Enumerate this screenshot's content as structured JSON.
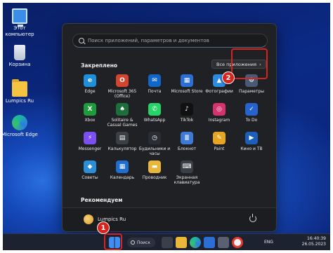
{
  "desktop": {
    "icons": [
      {
        "label": "Этот компьютер",
        "icon": "this-pc-icon"
      },
      {
        "label": "Корзина",
        "icon": "recycle-bin-icon"
      },
      {
        "label": "Lumpics Ru",
        "icon": "folder-icon"
      },
      {
        "label": "Microsoft Edge",
        "icon": "edge-icon"
      }
    ]
  },
  "start_menu": {
    "search_placeholder": "Поиск приложений, параметров и документов",
    "pinned_title": "Закреплено",
    "all_apps_label": "Все приложения",
    "all_apps_chevron": "›",
    "apps": [
      {
        "label": "Edge",
        "color": "#1f8fdc",
        "glyph": "e"
      },
      {
        "label": "Microsoft 365 (Office)",
        "color": "#d4452f",
        "glyph": "O"
      },
      {
        "label": "Почта",
        "color": "#1266c8",
        "glyph": "✉"
      },
      {
        "label": "Microsoft Store",
        "color": "#2c6fd4",
        "glyph": "▦"
      },
      {
        "label": "Фотографии",
        "color": "#2b8be0",
        "glyph": "▲"
      },
      {
        "label": "Параметры",
        "color": "#4a5a74",
        "glyph": "⚙"
      },
      {
        "label": "Xbox",
        "color": "#1e9c3c",
        "glyph": "X"
      },
      {
        "label": "Solitaire & Casual Games",
        "color": "#1c6e3a",
        "glyph": "♠"
      },
      {
        "label": "WhatsApp",
        "color": "#25d366",
        "glyph": "✆"
      },
      {
        "label": "TikTok",
        "color": "#111111",
        "glyph": "♪"
      },
      {
        "label": "Instagram",
        "color": "#d6336c",
        "glyph": "◎"
      },
      {
        "label": "To Do",
        "color": "#2564cf",
        "glyph": "✓"
      },
      {
        "label": "Messenger",
        "color": "#7b4ff0",
        "glyph": "⚡"
      },
      {
        "label": "Калькулятор",
        "color": "#3b3f46",
        "glyph": "▤"
      },
      {
        "label": "Будильники и часы",
        "color": "#2a2d33",
        "glyph": "◷"
      },
      {
        "label": "Блокнот",
        "color": "#3c7ad6",
        "glyph": "≣"
      },
      {
        "label": "Paint",
        "color": "#e8a521",
        "glyph": "✎"
      },
      {
        "label": "Кино и ТВ",
        "color": "#1b5fb8",
        "glyph": "▶"
      },
      {
        "label": "Советы",
        "color": "#2a8fd8",
        "glyph": "◆"
      },
      {
        "label": "Календарь",
        "color": "#1f6fd0",
        "glyph": "▦"
      },
      {
        "label": "Проводник",
        "color": "#e9b73a",
        "glyph": "▬"
      },
      {
        "label": "Экранная клавиатура",
        "color": "#3a3e46",
        "glyph": "⌨"
      }
    ],
    "recommended_title": "Рекомендуем",
    "user_name": "Lumpics Ru"
  },
  "taskbar": {
    "search_label": "Поиск",
    "language": "ENG",
    "time": "16:40:39",
    "date": "26.05.2023"
  },
  "annotations": {
    "badge1": "1",
    "badge2": "2",
    "highlight_color": "#d7241c"
  }
}
